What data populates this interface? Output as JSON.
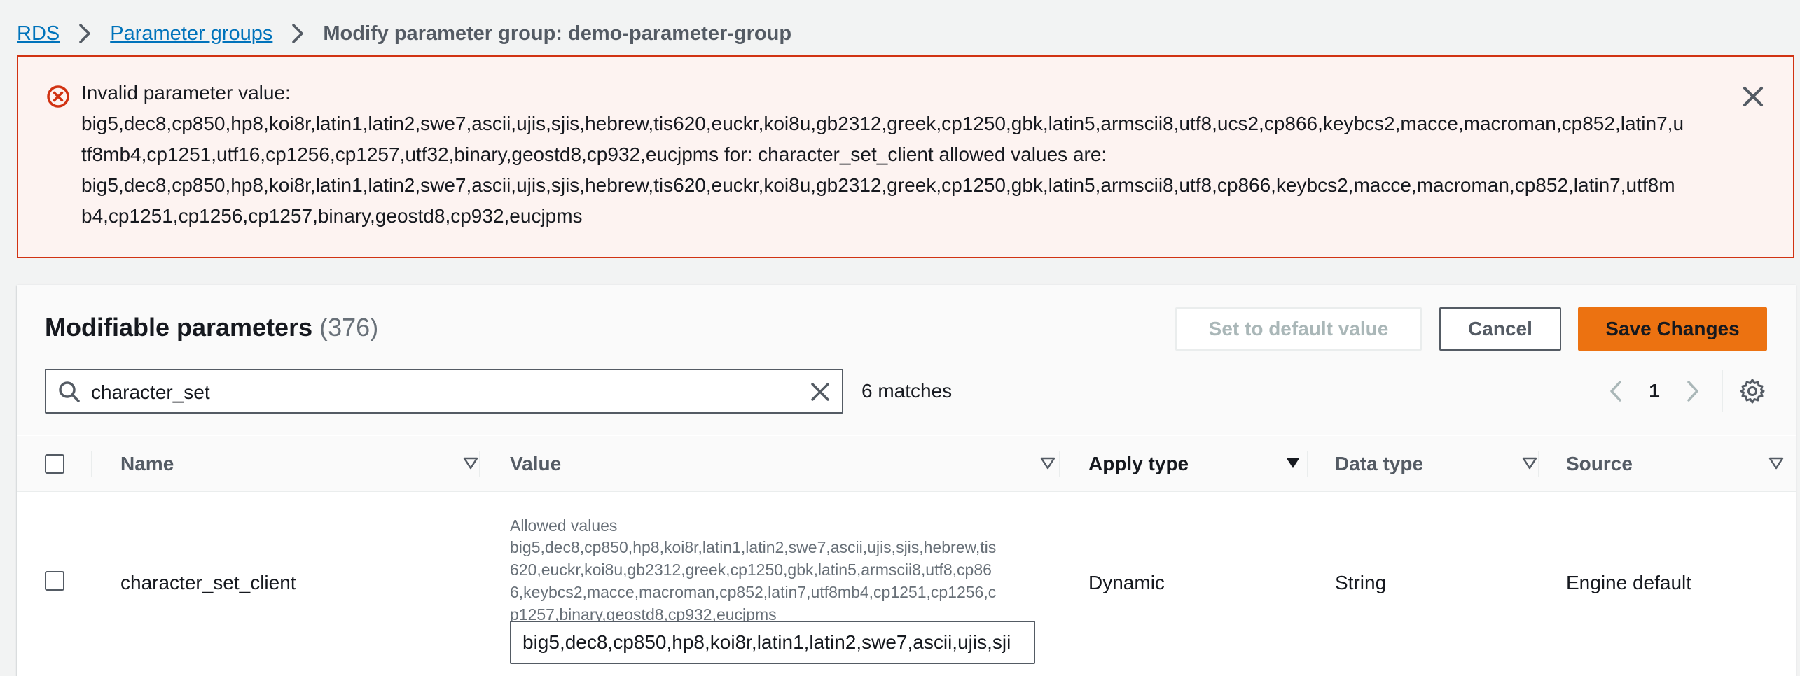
{
  "breadcrumb": {
    "items": [
      "RDS",
      "Parameter groups"
    ],
    "current": "Modify parameter group: demo-parameter-group"
  },
  "alert": {
    "lines": [
      "Invalid parameter value:",
      "big5,dec8,cp850,hp8,koi8r,latin1,latin2,swe7,ascii,ujis,sjis,hebrew,tis620,euckr,koi8u,gb2312,greek,cp1250,gbk,latin5,armscii8,utf8,ucs2,cp866,keybcs2,macce,macroman,cp852,latin7,u",
      "tf8mb4,cp1251,utf16,cp1256,cp1257,utf32,binary,geostd8,cp932,eucjpms for: character_set_client allowed values are:",
      "big5,dec8,cp850,hp8,koi8r,latin1,latin2,swe7,ascii,ujis,sjis,hebrew,tis620,euckr,koi8u,gb2312,greek,cp1250,gbk,latin5,armscii8,utf8,cp866,keybcs2,macce,macroman,cp852,latin7,utf8m",
      "b4,cp1251,cp1256,cp1257,binary,geostd8,cp932,eucjpms"
    ],
    "icon": "error-circle-icon",
    "status_color": "#d13212"
  },
  "panel": {
    "title": "Modifiable parameters",
    "count": "(376)",
    "buttons": {
      "set_default": "Set to default value",
      "cancel": "Cancel",
      "save": "Save Changes"
    },
    "search": {
      "value": "character_set"
    },
    "matches": "6 matches",
    "page": "1"
  },
  "table": {
    "columns": [
      "Name",
      "Value",
      "Apply type",
      "Data type",
      "Source"
    ],
    "rows": [
      {
        "name": "character_set_client",
        "allowed_label": "Allowed values",
        "allowed_lines": [
          "big5,dec8,cp850,hp8,koi8r,latin1,latin2,swe7,ascii,ujis,sjis,hebrew,tis",
          "620,euckr,koi8u,gb2312,greek,cp1250,gbk,latin5,armscii8,utf8,cp86",
          "6,keybcs2,macce,macroman,cp852,latin7,utf8mb4,cp1251,cp1256,c",
          "p1257,binary,geostd8,cp932,eucjpms"
        ],
        "value": "big5,dec8,cp850,hp8,koi8r,latin1,latin2,swe7,ascii,ujis,sji",
        "apply_type": "Dynamic",
        "data_type": "String",
        "source": "Engine default"
      }
    ]
  },
  "colors": {
    "link": "#0073bb",
    "primary_button": "#ec7211",
    "error": "#d13212"
  }
}
